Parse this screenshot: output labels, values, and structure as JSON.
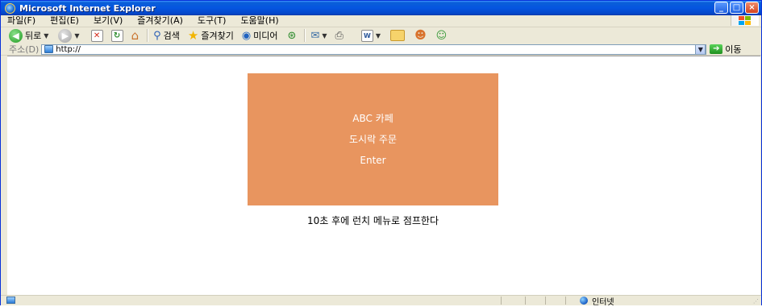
{
  "window": {
    "title": "Microsoft Internet Explorer",
    "controls": [
      "_",
      "□",
      "×"
    ]
  },
  "menu": [
    "파일(F)",
    "편집(E)",
    "보기(V)",
    "즐겨찾기(A)",
    "도구(T)",
    "도움말(H)"
  ],
  "toolbar": {
    "back_label": "뒤로",
    "search_label": "검색",
    "favorites_label": "즐겨찾기",
    "media_label": "미디어"
  },
  "address": {
    "label": "주소(D)",
    "value": "http://",
    "go_label": "이동"
  },
  "page": {
    "banner_lines": [
      "ABC 카페",
      "도시락 주문",
      "Enter"
    ],
    "notice": "10초 후에 런치 메뉴로 점프한다"
  },
  "status": {
    "zone": "인터넷"
  },
  "colors": {
    "banner_bg": "#e8955f",
    "title_bar": "#0555e0",
    "chrome": "#ece9d8"
  }
}
